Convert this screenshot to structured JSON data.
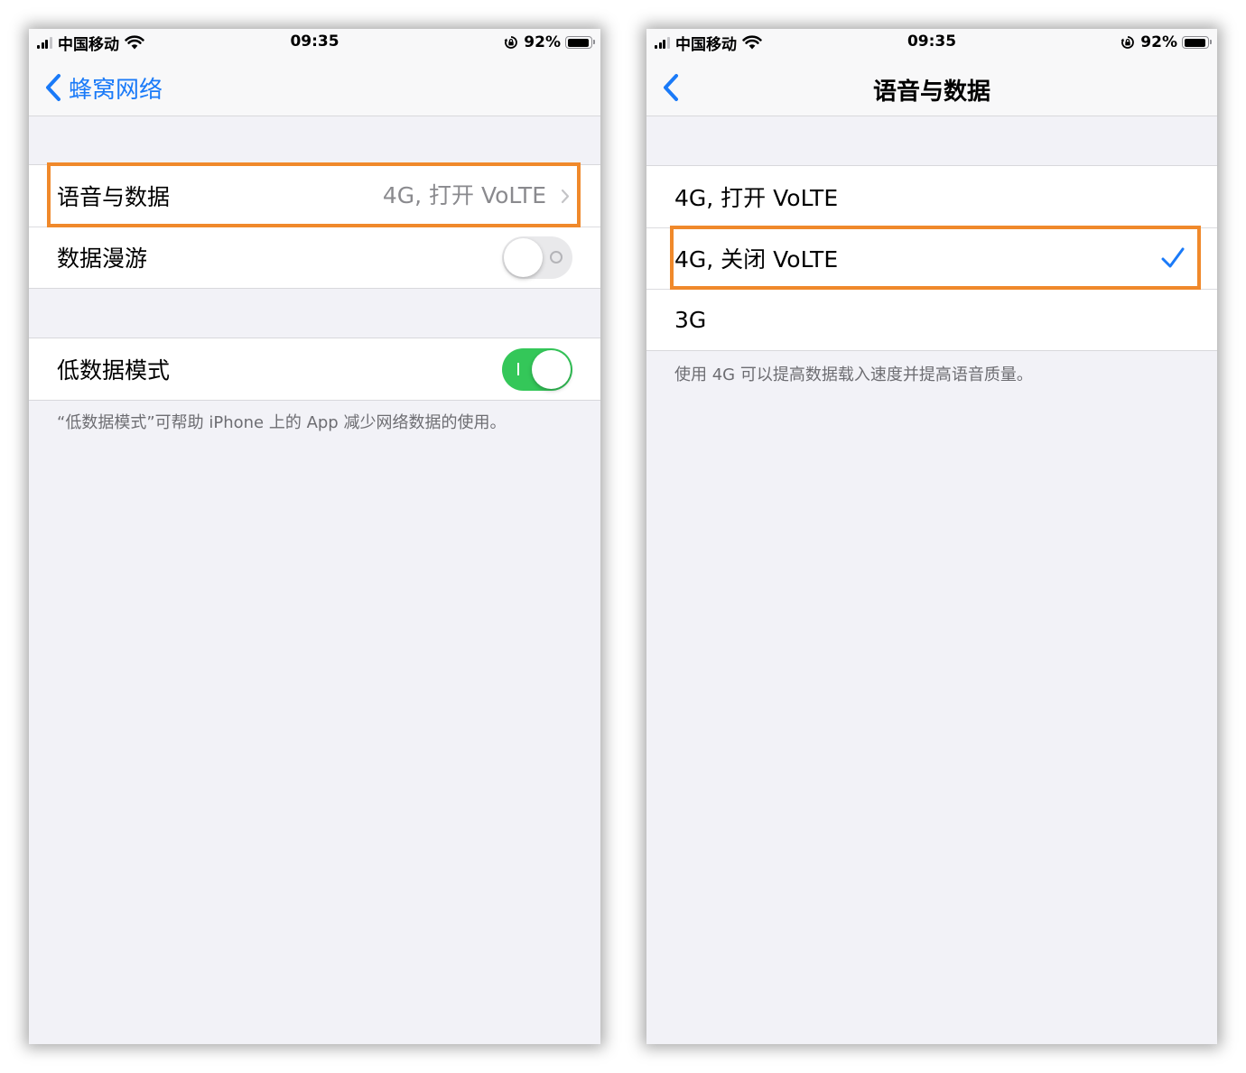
{
  "left_screen": {
    "status_bar": {
      "carrier": "中国移动",
      "time": "09:35",
      "battery_percent": "92%",
      "battery_level": 0.92
    },
    "nav": {
      "back_label": "蜂窝网络"
    },
    "group1": {
      "voice_data": {
        "label": "语音与数据",
        "value": "4G, 打开 VoLTE"
      },
      "data_roaming": {
        "label": "数据漫游",
        "toggle_on": false
      }
    },
    "group2": {
      "low_data_mode": {
        "label": "低数据模式",
        "toggle_on": true
      }
    },
    "footnote": "“低数据模式”可帮助 iPhone 上的 App 减少网络数据的使用。"
  },
  "right_screen": {
    "status_bar": {
      "carrier": "中国移动",
      "time": "09:35",
      "battery_percent": "92%",
      "battery_level": 0.92
    },
    "nav": {
      "title": "语音与数据"
    },
    "options": [
      {
        "label": "4G, 打开 VoLTE",
        "selected": false
      },
      {
        "label": "4G, 关闭 VoLTE",
        "selected": true
      },
      {
        "label": "3G",
        "selected": false
      }
    ],
    "footnote": "使用 4G 可以提高数据载入速度并提高语音质量。"
  },
  "colors": {
    "accent": "#1a7af8",
    "toggle_on": "#34c759",
    "highlight_border": "#f0892b",
    "grouped_background": "#f2f2f7"
  }
}
